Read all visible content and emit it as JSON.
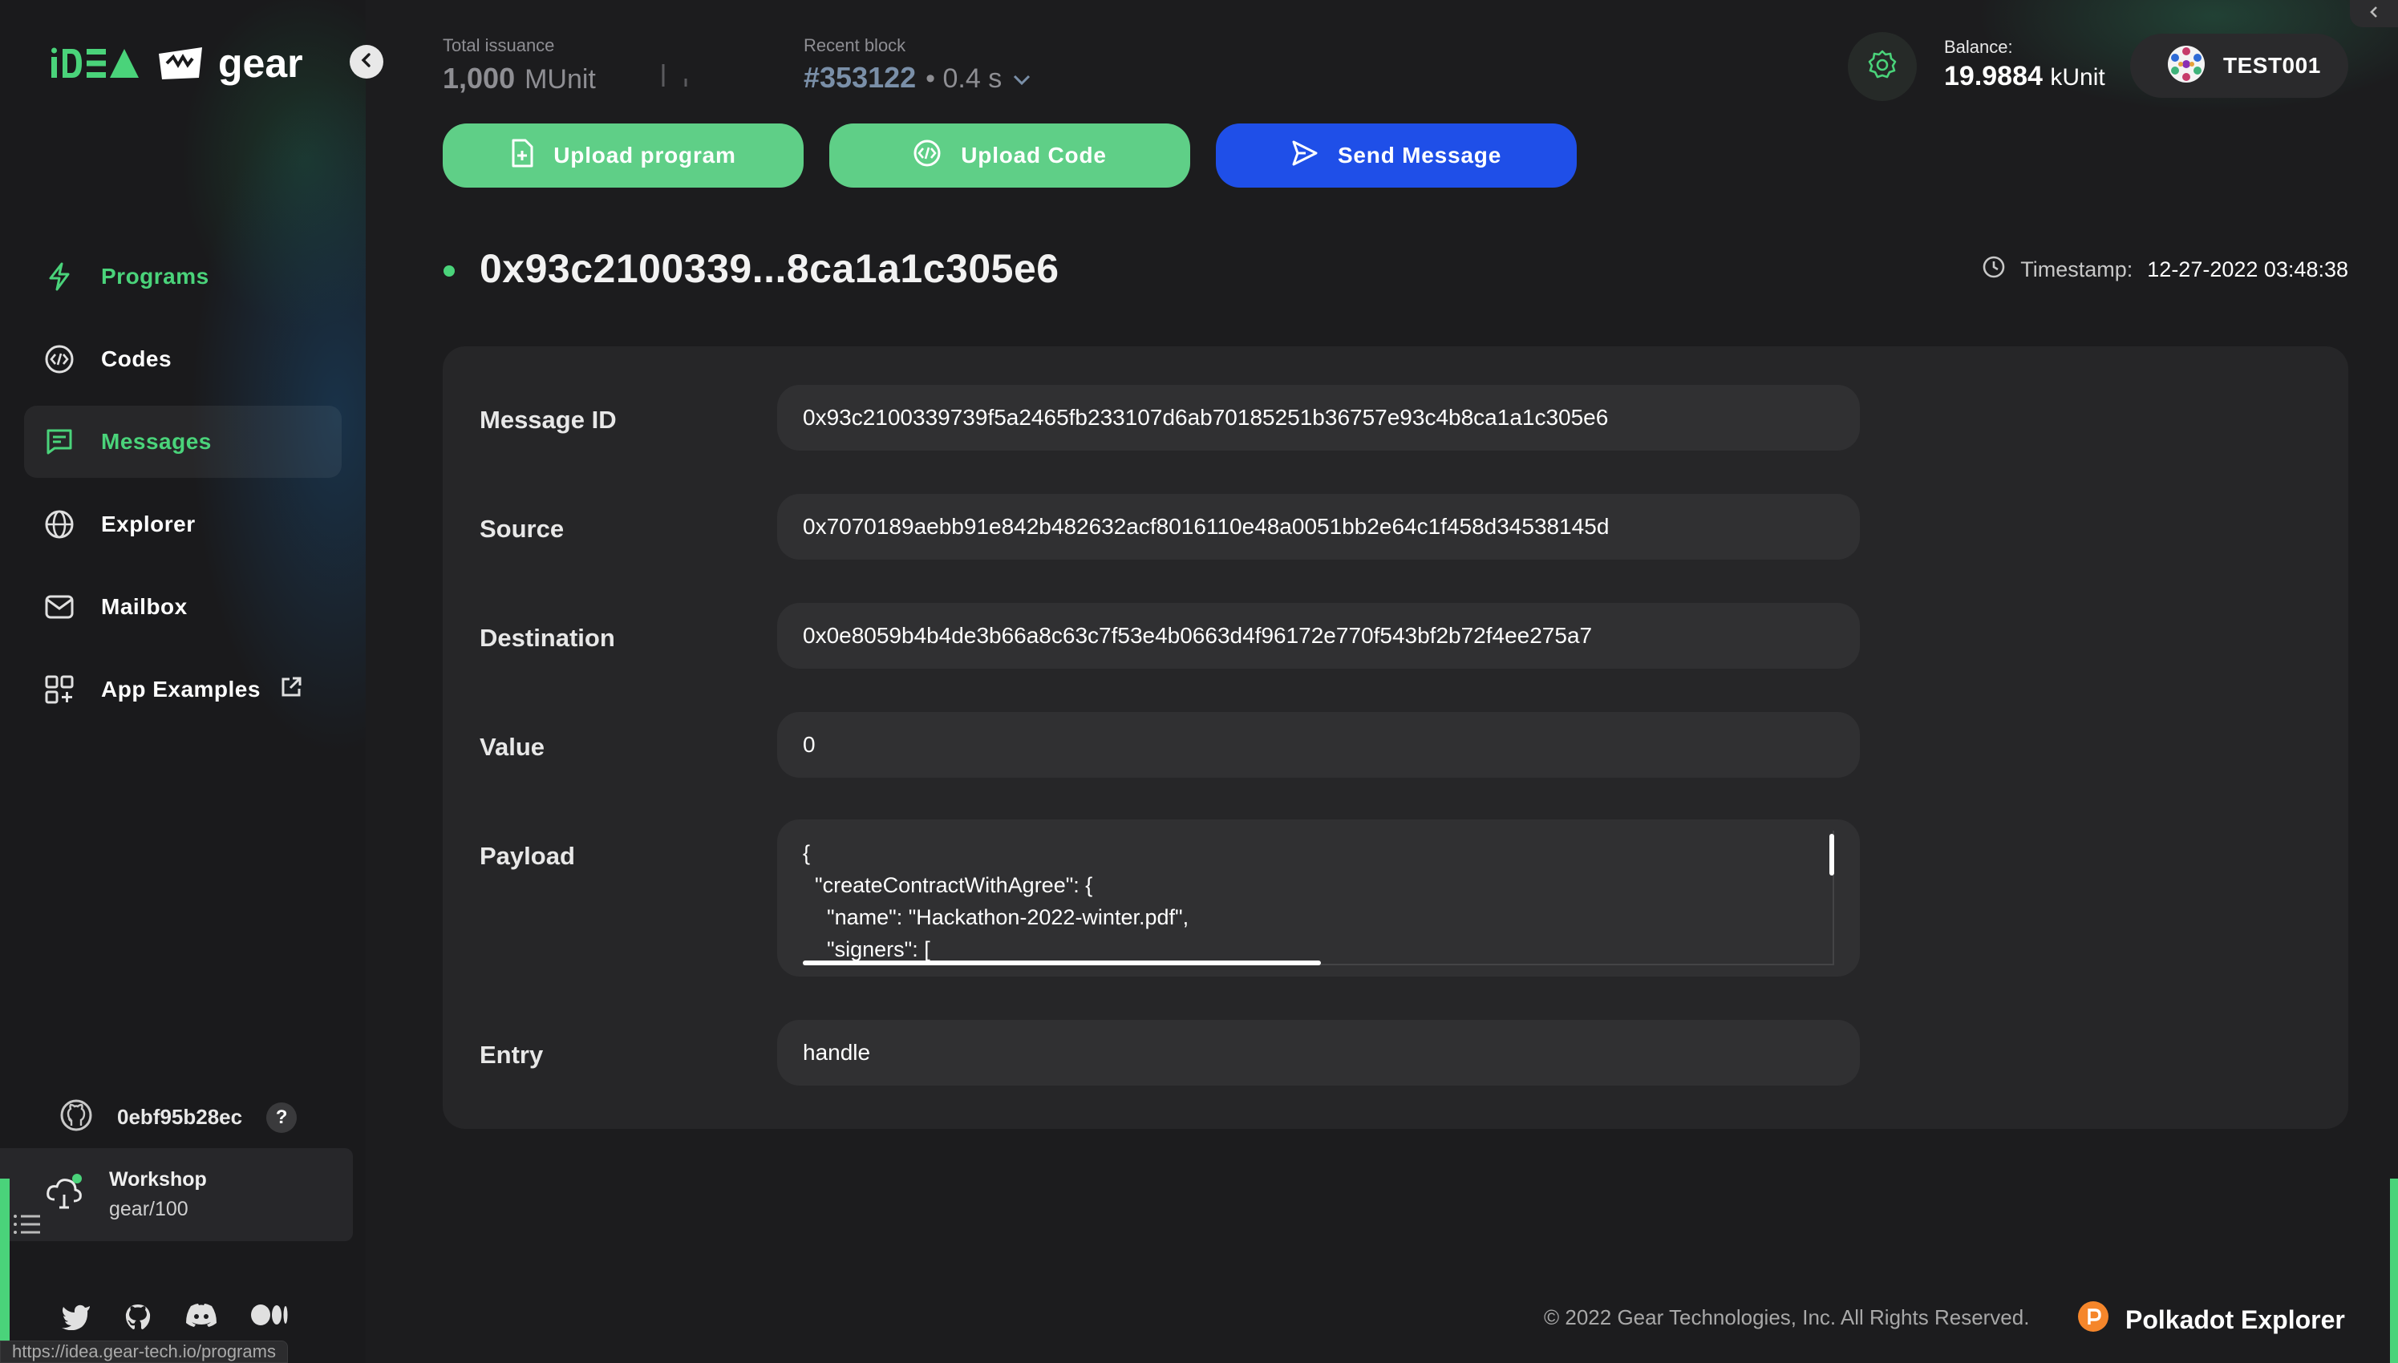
{
  "header": {
    "total_issuance_label": "Total issuance",
    "total_issuance_value": "1,000",
    "total_issuance_unit": "MUnit",
    "recent_block_label": "Recent block",
    "recent_block_value": "#353122",
    "recent_block_time": "• 0.4 s",
    "balance_label": "Balance:",
    "balance_value": "19.9884",
    "balance_unit": "kUnit",
    "account_name": "TEST001"
  },
  "logo": {
    "idea_text": "iDEA",
    "gear_text": "gear"
  },
  "sidebar": {
    "items": [
      {
        "label": "Programs",
        "icon": "lightning-icon"
      },
      {
        "label": "Codes",
        "icon": "code-icon"
      },
      {
        "label": "Messages",
        "icon": "message-icon",
        "active": true
      },
      {
        "label": "Explorer",
        "icon": "globe-icon"
      },
      {
        "label": "Mailbox",
        "icon": "mail-icon"
      },
      {
        "label": "App Examples",
        "icon": "apps-icon"
      }
    ],
    "git_hash": "0ebf95b28ec",
    "help_label": "?",
    "workshop_title": "Workshop",
    "workshop_sub": "gear/100"
  },
  "actions": {
    "upload_program": "Upload program",
    "upload_code": "Upload Code",
    "send_message": "Send Message"
  },
  "page": {
    "title": "0x93c2100339...8ca1a1c305e6",
    "timestamp_label": "Timestamp:",
    "timestamp_value": "12-27-2022 03:48:38"
  },
  "fields": {
    "message_id_label": "Message ID",
    "message_id_value": "0x93c2100339739f5a2465fb233107d6ab70185251b36757e93c4b8ca1a1c305e6",
    "source_label": "Source",
    "source_value": "0x7070189aebb91e842b482632acf8016110e48a0051bb2e64c1f458d34538145d",
    "destination_label": "Destination",
    "destination_value": "0x0e8059b4b4de3b66a8c63c7f53e4b0663d4f96172e770f543bf2b72f4ee275a7",
    "value_label": "Value",
    "value_value": "0",
    "payload_label": "Payload",
    "payload_value": "{\n  \"createContractWithAgree\": {\n    \"name\": \"Hackathon-2022-winter.pdf\",\n    \"signers\": [",
    "entry_label": "Entry",
    "entry_value": "handle"
  },
  "footer": {
    "copyright": "© 2022 Gear Technologies, Inc. All Rights Reserved.",
    "polkadot_label": "Polkadot Explorer",
    "status_url": "https://idea.gear-tech.io/programs"
  },
  "colors": {
    "accent_green": "#4ad37a",
    "button_green": "#5fcf87",
    "button_blue": "#1f4fe8",
    "background": "#1c1c1e",
    "card": "#262628"
  }
}
